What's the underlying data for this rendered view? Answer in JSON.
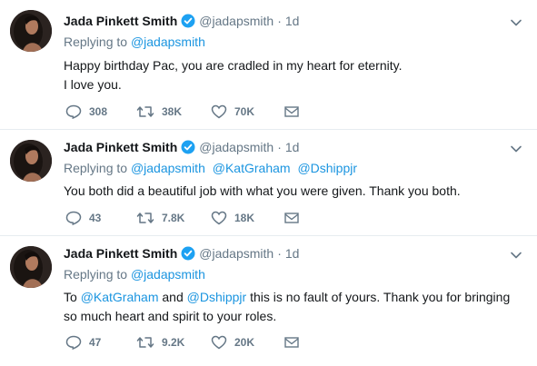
{
  "tweets": [
    {
      "author_name": "Jada Pinkett Smith",
      "handle": "@jadapsmith",
      "separator": "·",
      "time": "1d",
      "replying_label": "Replying to",
      "replying_to": [
        "@jadapsmith"
      ],
      "text_lines": [
        "Happy birthday Pac, you are cradled in my heart for eternity.",
        "I love you."
      ],
      "replies": "308",
      "retweets": "38K",
      "likes": "70K"
    },
    {
      "author_name": "Jada Pinkett Smith",
      "handle": "@jadapsmith",
      "separator": "·",
      "time": "1d",
      "replying_label": "Replying to",
      "replying_to": [
        "@jadapsmith",
        "@KatGraham",
        "@Dshippjr"
      ],
      "text_lines": [
        "You both did a beautiful job with what you were given. Thank you both."
      ],
      "replies": "43",
      "retweets": "7.8K",
      "likes": "18K"
    },
    {
      "author_name": "Jada Pinkett Smith",
      "handle": "@jadapsmith",
      "separator": "·",
      "time": "1d",
      "replying_label": "Replying to",
      "replying_to": [
        "@jadapsmith"
      ],
      "text_parts": {
        "t1": "To ",
        "m1": "@KatGraham",
        "t2": " and ",
        "m2": "@Dshippjr",
        "t3": " this is no fault of yours. Thank you for bringing",
        "line2": "so much heart and spirit to your roles."
      },
      "replies": "47",
      "retweets": "9.2K",
      "likes": "20K"
    }
  ],
  "colors": {
    "name": "#14171a",
    "secondary": "#657786",
    "link": "#1b95e0",
    "verified": "#1da1f2",
    "divider": "#e6ecf0"
  },
  "icons": {
    "verified": "verified-badge-icon",
    "caret": "chevron-down-icon",
    "reply": "reply-icon",
    "retweet": "retweet-icon",
    "like": "heart-icon",
    "dm": "envelope-icon"
  }
}
